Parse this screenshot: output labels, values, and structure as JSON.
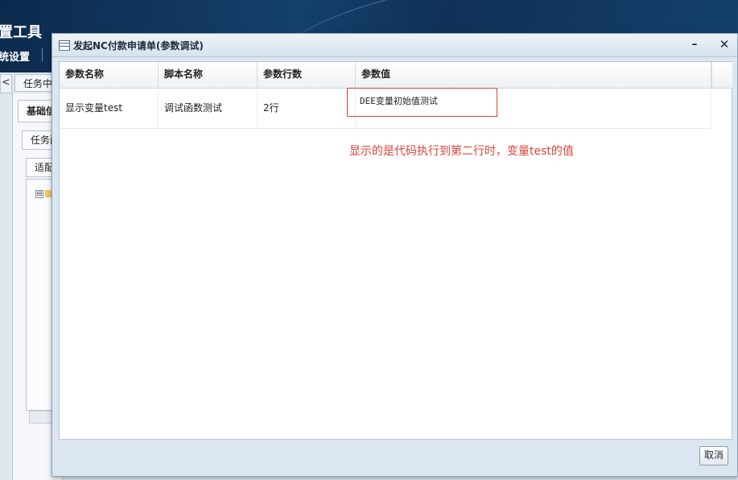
{
  "app": {
    "title": "置工具",
    "menu_item": "统设置"
  },
  "background": {
    "collapse_glyph": "<",
    "tab_label": "任务中",
    "sub_tab_1": "基础信",
    "sub_tab_2": "任务配",
    "sub_tab_3": "适配",
    "tree_toggle": "⊟"
  },
  "dialog": {
    "title": "发起NC付款申请单(参数调试)",
    "minimize_glyph": "–",
    "close_glyph": "✕",
    "cancel_label": "取消"
  },
  "grid": {
    "columns": [
      "参数名称",
      "脚本名称",
      "参数行数",
      "参数值"
    ],
    "rows": [
      {
        "param_name": "显示变量test",
        "script_name": "调试函数测试",
        "line_count": "2行",
        "param_value": "DEE变量初始值测试"
      }
    ]
  },
  "annotation": {
    "text": "显示的是代码执行到第二行时，变量test的值",
    "color": "#d9443a"
  }
}
